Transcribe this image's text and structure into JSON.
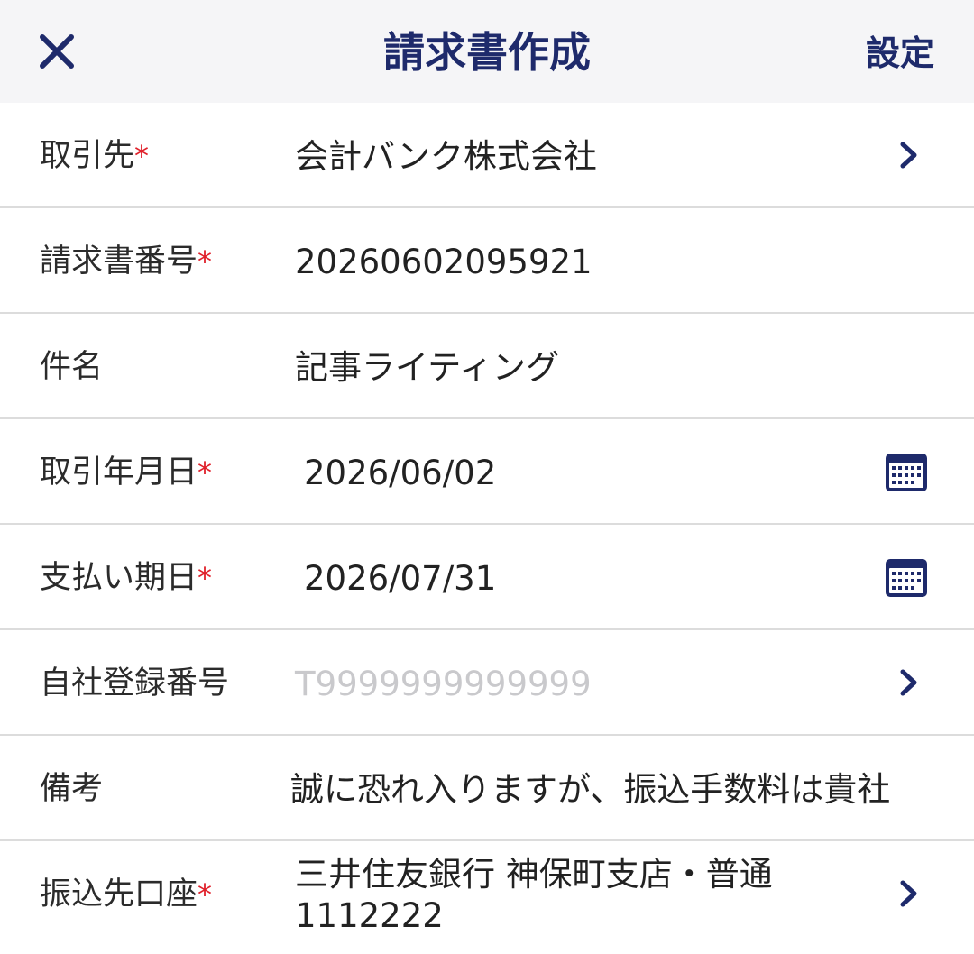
{
  "header": {
    "title": "請求書作成",
    "settings_label": "設定",
    "close_icon": "close-icon"
  },
  "colors": {
    "navy": "#1e2a6b",
    "required": "#e0202a",
    "divider": "#dcdcdc",
    "placeholder": "#c9c9cc"
  },
  "form": {
    "required_mark": "*",
    "client": {
      "label": "取引先",
      "value": "会計バンク株式会社"
    },
    "invoice_number": {
      "label": "請求書番号",
      "value": "20260602095921"
    },
    "subject": {
      "label": "件名",
      "value": "記事ライティング"
    },
    "transaction_date": {
      "label": "取引年月日",
      "value": "2026/06/02"
    },
    "due_date": {
      "label": "支払い期日",
      "value": "2026/07/31"
    },
    "registration_number": {
      "label": "自社登録番号",
      "placeholder": "T9999999999999"
    },
    "remarks": {
      "label": "備考",
      "value": "誠に恐れ入りますが、振込手数料は貴社"
    },
    "bank_account": {
      "label": "振込先口座",
      "value": "三井住友銀行 神保町支店・普通 1112222"
    }
  }
}
